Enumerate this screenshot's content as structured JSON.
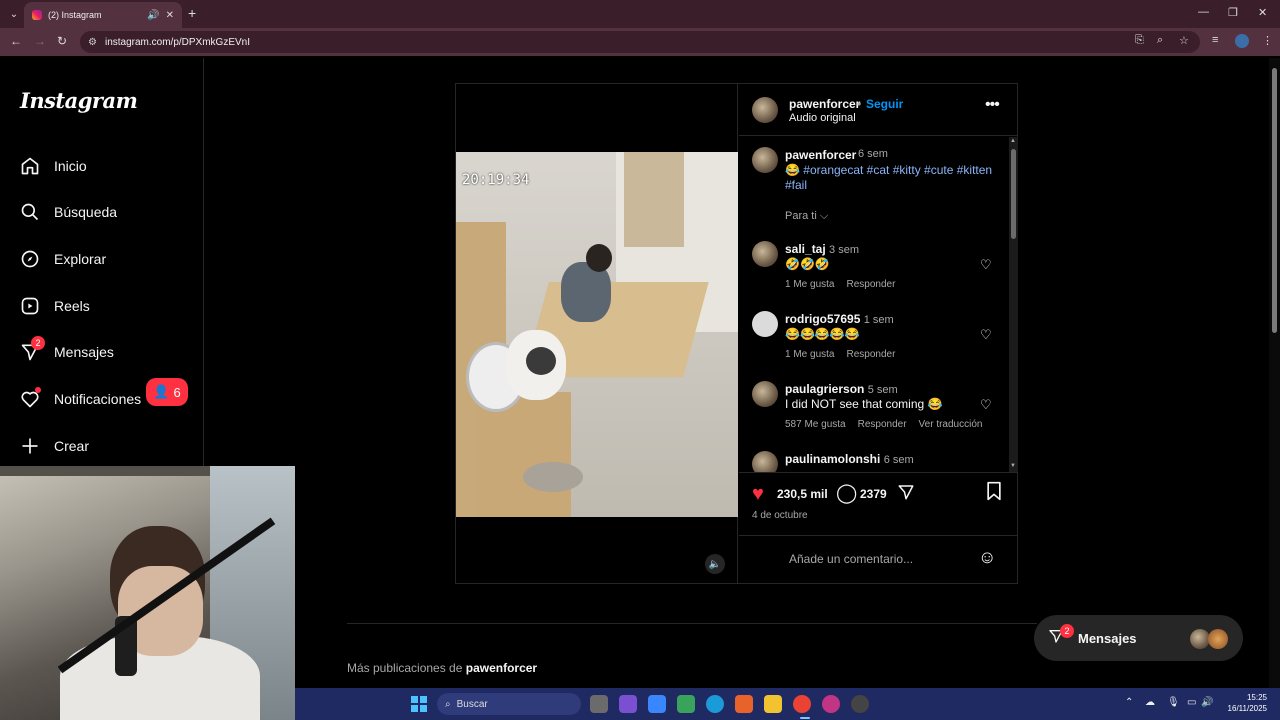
{
  "browser": {
    "tab_title": "(2) Instagram",
    "url": "instagram.com/p/DPXmkGzEVnI",
    "new_tab": "+",
    "minimize": "—",
    "restore": "❐",
    "close": "✕"
  },
  "sidebar": {
    "logo": "Instagram",
    "items": [
      {
        "label": "Inicio",
        "icon": "home-icon"
      },
      {
        "label": "Búsqueda",
        "icon": "search-icon"
      },
      {
        "label": "Explorar",
        "icon": "compass-icon"
      },
      {
        "label": "Reels",
        "icon": "reels-icon"
      },
      {
        "label": "Mensajes",
        "icon": "messenger-icon",
        "badge": "2"
      },
      {
        "label": "Notificaciones",
        "icon": "heart-icon"
      },
      {
        "label": "Crear",
        "icon": "plus-icon"
      }
    ],
    "notif_count": "6"
  },
  "post": {
    "video_timestamp": "20:19:34",
    "author": "pawenforcer",
    "separator": "•",
    "follow": "Seguir",
    "audio": "Audio original",
    "caption": {
      "username": "pawenforcer",
      "time": "6 sem",
      "emoji": "😂",
      "hashtags": "#orangecat #cat #kitty #cute #kitten #fail"
    },
    "para_ti": "Para ti ⌵",
    "comments": [
      {
        "user": "sali_taj",
        "time": "3 sem",
        "text": "🤣🤣🤣",
        "likes": "1 Me gusta",
        "reply": "Responder",
        "translate": ""
      },
      {
        "user": "rodrigo57695",
        "time": "1 sem",
        "text": "😂😂😂😂😂",
        "likes": "1 Me gusta",
        "reply": "Responder",
        "translate": ""
      },
      {
        "user": "paulagrierson",
        "time": "5 sem",
        "text": "I did NOT see that coming 😂",
        "likes": "587 Me gusta",
        "reply": "Responder",
        "translate": "Ver traducción"
      },
      {
        "user": "paulinamolonshi",
        "time": "6 sem",
        "text": "",
        "likes": "",
        "reply": "",
        "translate": ""
      }
    ],
    "like_count": "230,5 mil",
    "comment_count": "2379",
    "date": "4 de octubre",
    "add_comment_placeholder": "Añade un comentario..."
  },
  "more_posts": {
    "prefix": "Más publicaciones de",
    "user": "pawenforcer"
  },
  "messages_pill": {
    "label": "Mensajes",
    "badge": "2"
  },
  "taskbar": {
    "search": "Buscar",
    "time": "15:25",
    "date": "16/11/2025"
  },
  "colors": {
    "background": "#000000",
    "accent": "#0095f6",
    "notification": "#ff3040",
    "hashtag": "#8ab4f8"
  }
}
